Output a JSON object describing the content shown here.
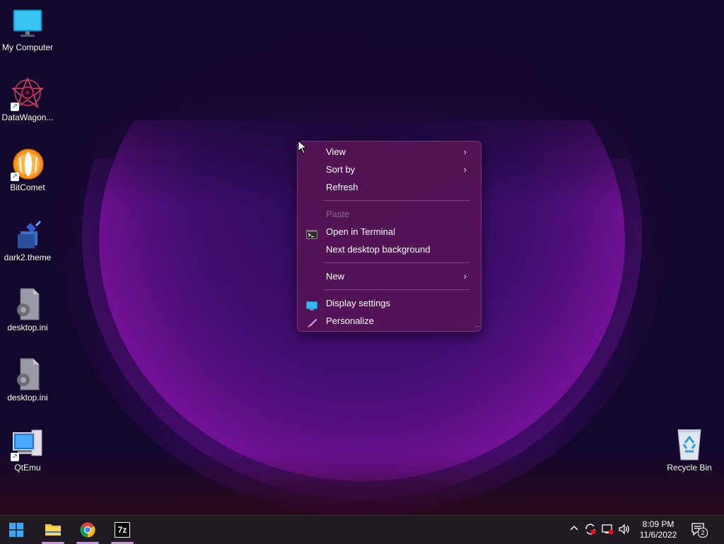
{
  "desktop": {
    "icons": [
      {
        "label": "My Computer",
        "icon": "monitor-icon"
      },
      {
        "label": "DataWagon...",
        "icon": "datawagon-logo-icon"
      },
      {
        "label": "BitComet",
        "icon": "bitcomet-logo-icon"
      },
      {
        "label": "dark2.theme",
        "icon": "theme-file-icon"
      },
      {
        "label": "desktop.ini",
        "icon": "settings-file-icon"
      },
      {
        "label": "desktop.ini",
        "icon": "settings-file-icon"
      },
      {
        "label": "QtEmu",
        "icon": "qtemu-icon"
      },
      {
        "label": "Recycle Bin",
        "icon": "recycle-bin-icon"
      }
    ]
  },
  "context_menu": {
    "items": [
      {
        "label": "View",
        "has_submenu": true,
        "enabled": true
      },
      {
        "label": "Sort by",
        "has_submenu": true,
        "enabled": true
      },
      {
        "label": "Refresh",
        "has_submenu": false,
        "enabled": true
      },
      {
        "label": "Paste",
        "has_submenu": false,
        "enabled": false
      },
      {
        "label": "Open in Terminal",
        "has_submenu": false,
        "enabled": true,
        "icon": "terminal-icon"
      },
      {
        "label": "Next desktop background",
        "has_submenu": false,
        "enabled": true
      },
      {
        "label": "New",
        "has_submenu": true,
        "enabled": true
      },
      {
        "label": "Display settings",
        "has_submenu": false,
        "enabled": true,
        "icon": "display-icon"
      },
      {
        "label": "Personalize",
        "has_submenu": false,
        "enabled": true,
        "icon": "brush-icon"
      }
    ]
  },
  "taskbar": {
    "pinned": [
      "start-icon",
      "file-explorer-icon",
      "chrome-icon",
      "7zip-icon"
    ],
    "tray": {
      "clock_time": "8:09 PM",
      "clock_date": "11/6/2022",
      "notification_count": "2"
    }
  },
  "colors": {
    "menu_background": "#58145a",
    "taskbar_background": "#201a22",
    "active_indicator": "#c29ad0"
  }
}
